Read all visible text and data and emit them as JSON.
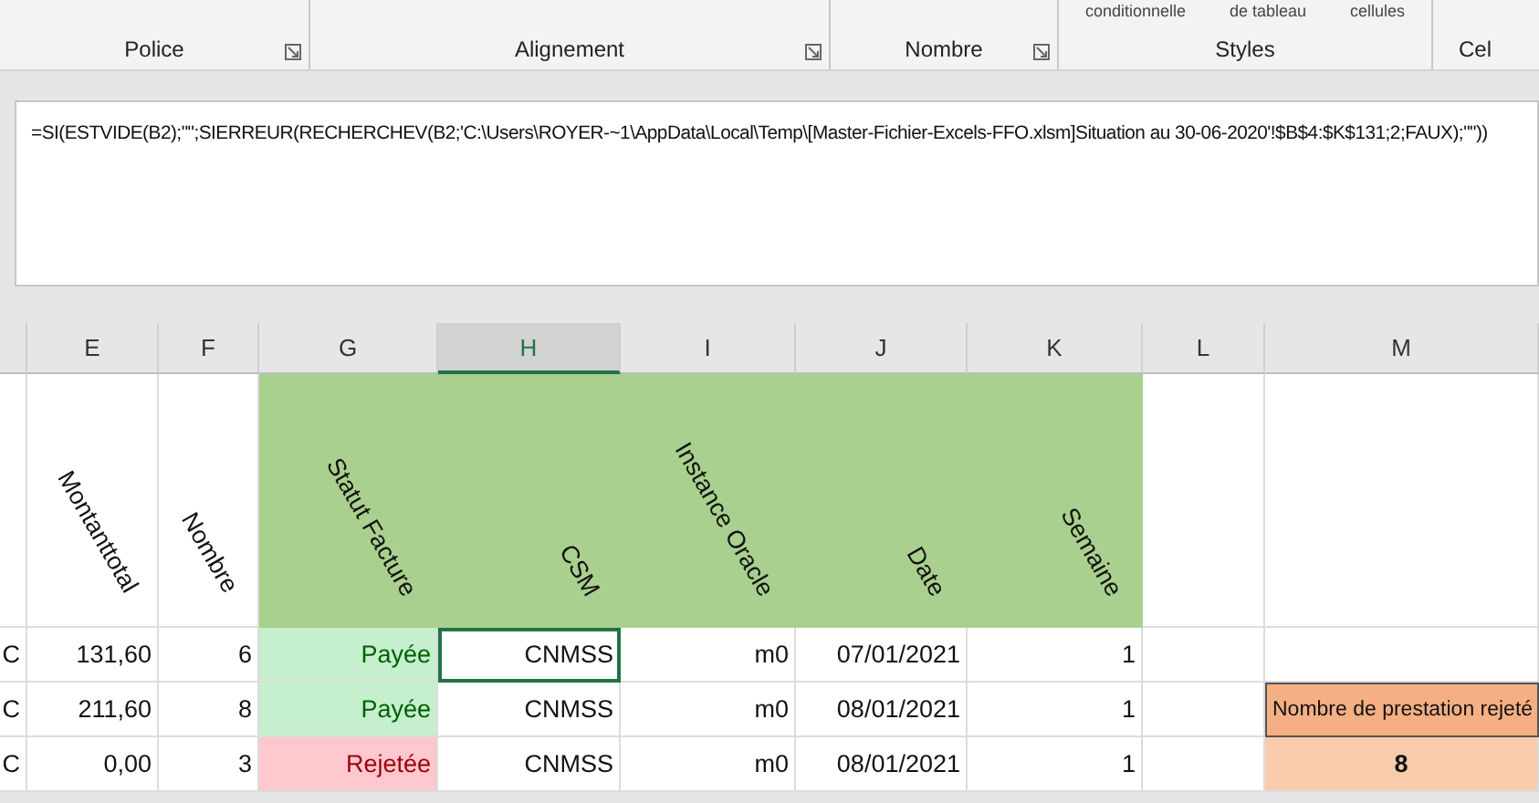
{
  "ribbon": {
    "groups": [
      {
        "label": "Police",
        "launcher": true
      },
      {
        "label": "Alignement",
        "launcher": true
      },
      {
        "label": "Nombre",
        "launcher": true
      },
      {
        "label": "Styles",
        "commands": [
          "conditionnelle",
          "de tableau",
          "cellules"
        ]
      },
      {
        "label": "Cel"
      }
    ]
  },
  "formula_bar": {
    "value": "=SI(ESTVIDE(B2);\"\";SIERREUR(RECHERCHEV(B2;'C:\\Users\\ROYER-~1\\AppData\\Local\\Temp\\[Master-Fichier-Excels-FFO.xlsm]Situation au 30-06-2020'!$B$4:$K$131;2;FAUX);\"\"))"
  },
  "sheet": {
    "columns": [
      {
        "selected": false
      },
      {
        "letter": "E",
        "selected": false
      },
      {
        "letter": "F",
        "selected": false
      },
      {
        "letter": "G",
        "selected": false
      },
      {
        "letter": "H",
        "selected": true
      },
      {
        "letter": "I",
        "selected": false
      },
      {
        "letter": "J",
        "selected": false
      },
      {
        "letter": "K",
        "selected": false
      },
      {
        "letter": "L",
        "selected": false
      },
      {
        "letter": "M",
        "selected": false
      }
    ],
    "header_cells": [
      {
        "highlighted": false
      },
      {
        "text": "Montanttotal",
        "highlighted": false
      },
      {
        "text": "Nombre",
        "highlighted": false
      },
      {
        "text": "Statut Facture",
        "highlighted": true
      },
      {
        "text": "CSM",
        "highlighted": true
      },
      {
        "text": "Instance Oracle",
        "highlighted": true
      },
      {
        "text": "Date",
        "highlighted": true
      },
      {
        "text": "Semaine",
        "highlighted": true
      },
      {
        "highlighted": false
      },
      {
        "highlighted": false
      }
    ],
    "rows": [
      {
        "cells": [
          {
            "text": "C",
            "kind": "plain",
            "selected": false
          },
          {
            "text": "131,60",
            "kind": "plain",
            "selected": false
          },
          {
            "text": "6",
            "kind": "plain",
            "selected": false
          },
          {
            "text": "Payée",
            "kind": "good",
            "selected": false
          },
          {
            "text": "CNMSS",
            "kind": "plain",
            "selected": true
          },
          {
            "text": "m0",
            "kind": "plain",
            "selected": false
          },
          {
            "text": "07/01/2021",
            "kind": "plain",
            "selected": false
          },
          {
            "text": "1",
            "kind": "plain",
            "selected": false
          },
          {
            "kind": "plain",
            "selected": false
          },
          {
            "kind": "plain",
            "selected": false
          }
        ]
      },
      {
        "cells": [
          {
            "text": "C",
            "kind": "plain",
            "selected": false
          },
          {
            "text": "211,60",
            "kind": "plain",
            "selected": false
          },
          {
            "text": "8",
            "kind": "plain",
            "selected": false
          },
          {
            "text": "Payée",
            "kind": "good",
            "selected": false
          },
          {
            "text": "CNMSS",
            "kind": "plain",
            "selected": false
          },
          {
            "text": "m0",
            "kind": "plain",
            "selected": false
          },
          {
            "text": "08/01/2021",
            "kind": "plain",
            "selected": false
          },
          {
            "text": "1",
            "kind": "plain",
            "selected": false
          },
          {
            "kind": "plain",
            "selected": false
          },
          {
            "text": "Nombre de prestation rejeté",
            "kind": "note",
            "selected": false
          }
        ]
      },
      {
        "cells": [
          {
            "text": "C",
            "kind": "plain",
            "selected": false
          },
          {
            "text": "0,00",
            "kind": "plain",
            "selected": false
          },
          {
            "text": "3",
            "kind": "plain",
            "selected": false
          },
          {
            "text": "Rejetée",
            "kind": "bad",
            "selected": false
          },
          {
            "text": "CNMSS",
            "kind": "plain",
            "selected": false
          },
          {
            "text": "m0",
            "kind": "plain",
            "selected": false
          },
          {
            "text": "08/01/2021",
            "kind": "plain",
            "selected": false
          },
          {
            "text": "1",
            "kind": "plain",
            "selected": false
          },
          {
            "kind": "plain",
            "selected": false
          },
          {
            "text": "8",
            "kind": "note-value",
            "selected": false
          }
        ]
      }
    ]
  }
}
